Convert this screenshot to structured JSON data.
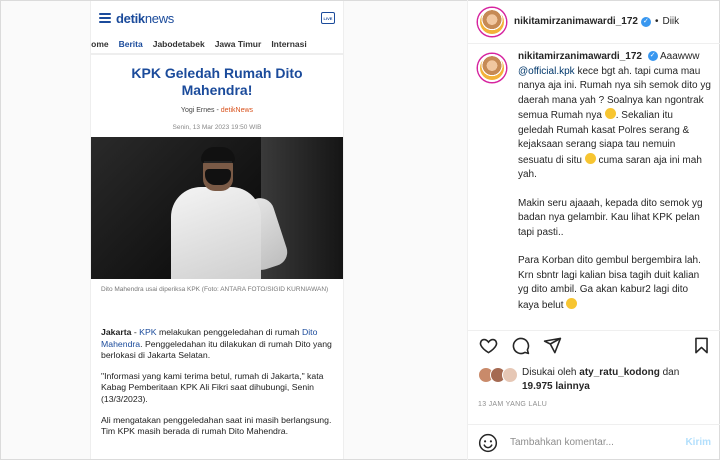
{
  "article": {
    "logo_main": "detik",
    "logo_sub": "news",
    "live_label": "LIVE",
    "nav": [
      "Home",
      "Berita",
      "Jabodetabek",
      "Jawa Timur",
      "Internasi"
    ],
    "title": "KPK Geledah Rumah Dito Mahendra!",
    "author": "Yogi Ernes",
    "source": "detikNews",
    "date": "Senin, 13 Mar 2023 19:50 WIB",
    "caption": "Dito Mahendra usai diperiksa KPK (Foto: ANTARA FOTO/SIGID KURNIAWAN)",
    "p1_lead": "Jakarta",
    "p1_dash": " - ",
    "p1_kpk": "KPK",
    "p1_mid": " melakukan penggeledahan di rumah ",
    "p1_name": "Dito Mahendra",
    "p1_rest": ". Penggeledahan itu dilakukan di rumah Dito yang berlokasi di Jakarta Selatan.",
    "p2": "\"Informasi yang kami terima betul, rumah di Jakarta,\" kata Kabag Pemberitaan KPK Ali Fikri saat dihubungi, Senin (13/3/2023).",
    "p3": "Ali mengatakan penggeledahan saat ini masih berlangsung. Tim KPK masih berada di rumah Dito Mahendra."
  },
  "panel": {
    "username": "nikitamirzanimawardi_172",
    "follow_label": "Diik",
    "comment": {
      "username": "nikitamirzanimawardi_172",
      "intro": "Aaawww",
      "mention": "@official.kpk",
      "p1a": "kece bgt ah. tapi cuma mau nanya aja ini. Rumah nya sih semok dito yg daerah mana yah ? Soalnya kan ngontrak semua Rumah nya",
      "p1b": ". Sekalian itu geledah Rumah kasat Polres serang & kejaksaan serang siapa tau nemuin sesuatu di situ",
      "p1c": "cuma saran aja ini mah yah.",
      "p2": "Makin seru ajaaah, kepada dito semok yg badan nya gelambir. Kau lihat KPK pelan tapi pasti..",
      "p3": "Para Korban dito gembul bergembira lah. Krn sbntr lagi kalian bisa tagih duit kalian yg dito ambil. Ga akan kabur2 lagi dito kaya belut"
    },
    "likes": {
      "prefix": "Disukai oleh",
      "user": "aty_ratu_kodong",
      "conj": "dan",
      "count": "19.975 lainnya"
    },
    "time": "13 JAM YANG LALU",
    "add_comment_placeholder": "Tambahkan komentar...",
    "post_label": "Kirim"
  },
  "icons": [
    "menu-icon",
    "live-icon",
    "verified-icon",
    "heart-icon",
    "comment-icon",
    "share-icon",
    "bookmark-icon",
    "emoji-icon"
  ],
  "colors": {
    "detik_blue": "#1b4b9b",
    "ig_link": "#00376b",
    "ig_blue": "#3897f0",
    "post_disabled": "#b2dffc"
  }
}
